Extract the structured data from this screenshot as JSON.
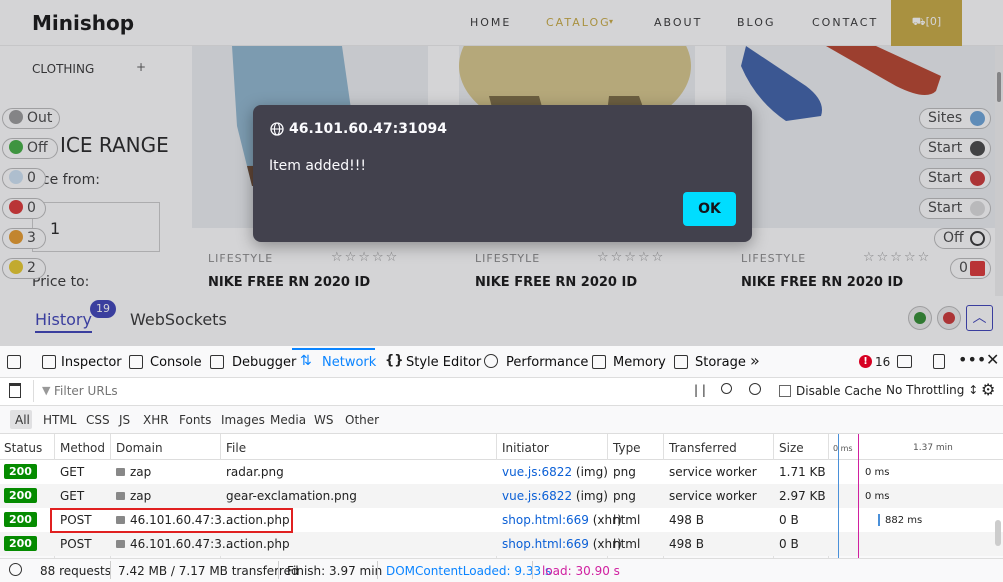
{
  "site": {
    "brand": "Minishop",
    "nav": [
      "HOME",
      "CATALOG",
      "ABOUT",
      "BLOG",
      "CONTACT"
    ],
    "cart_label": "⛟[0]",
    "sidebar_category": "CLOTHING",
    "sidebar_plus": "+",
    "price_range_title": "ICE RANGE",
    "price_from_label": "ice from:",
    "price_from_value": "1",
    "price_to_label": "Price to:",
    "products": [
      {
        "category": "LIFESTYLE",
        "name": "NIKE FREE RN 2020 ID",
        "stars": "☆☆☆☆☆"
      },
      {
        "category": "LIFESTYLE",
        "name": "NIKE FREE RN 2020 ID",
        "stars": "☆☆☆☆☆"
      },
      {
        "category": "LIFESTYLE",
        "name": "NIKE FREE RN 2020 ID",
        "stars": "☆☆☆☆☆"
      }
    ]
  },
  "zap": {
    "left_pills": [
      "Out",
      "Off",
      "0",
      "0",
      "3",
      "2"
    ],
    "right_pills": [
      "Sites",
      "Start",
      "Start",
      "Start",
      "Off",
      "0"
    ],
    "tabs": {
      "history": "History",
      "history_count": "19",
      "websockets": "WebSockets"
    }
  },
  "dialog": {
    "title": "46.101.60.47:31094",
    "message": "Item added!!!",
    "ok_label": "OK"
  },
  "devtools": {
    "tabs": [
      "Inspector",
      "Console",
      "Debugger",
      "Network",
      "Style Editor",
      "Performance",
      "Memory",
      "Storage"
    ],
    "active_tab": "Network",
    "error_count": "16",
    "filter_placeholder": "Filter URLs",
    "disable_cache_label": "Disable Cache",
    "throttling_label": "No Throttling ↕",
    "type_filters": [
      "All",
      "HTML",
      "CSS",
      "JS",
      "XHR",
      "Fonts",
      "Images",
      "Media",
      "WS",
      "Other"
    ],
    "columns": [
      "Status",
      "Method",
      "Domain",
      "File",
      "Initiator",
      "Type",
      "Transferred",
      "Size"
    ],
    "timeline_labels": [
      "0 ms",
      "1.37 min"
    ],
    "rows": [
      {
        "status": "200",
        "method": "GET",
        "domain": "zap",
        "file": "radar.png",
        "initiator_link": "vue.js:6822",
        "initiator_type": "(img)",
        "type": "png",
        "transferred": "service worker",
        "size": "1.71 KB",
        "timing": "0 ms"
      },
      {
        "status": "200",
        "method": "GET",
        "domain": "zap",
        "file": "gear-exclamation.png",
        "initiator_link": "vue.js:6822",
        "initiator_type": "(img)",
        "type": "png",
        "transferred": "service worker",
        "size": "2.97 KB",
        "timing": "0 ms"
      },
      {
        "status": "200",
        "method": "POST",
        "domain": "46.101.60.47:3...",
        "file": "action.php",
        "initiator_link": "shop.html:669",
        "initiator_type": "(xhr)",
        "type": "html",
        "transferred": "498 B",
        "size": "0 B",
        "timing": "882 ms"
      },
      {
        "status": "200",
        "method": "POST",
        "domain": "46.101.60.47:3...",
        "file": "action.php",
        "initiator_link": "shop.html:669",
        "initiator_type": "(xhr)",
        "type": "html",
        "transferred": "498 B",
        "size": "0 B",
        "timing": ""
      }
    ],
    "footer": {
      "requests": "88 requests",
      "transferred": "7.42 MB / 7.17 MB transferred",
      "finish": "Finish: 3.97 min",
      "dom_loaded": "DOMContentLoaded: 9.33 s",
      "load": "load: 30.90 s"
    }
  },
  "colors": {
    "accent": "#0a84ff",
    "status_ok": "#058b00",
    "dialog_bg": "#42414d",
    "ok_button": "#00ddff",
    "highlight": "#e02020",
    "cart": "#c8a93f"
  }
}
